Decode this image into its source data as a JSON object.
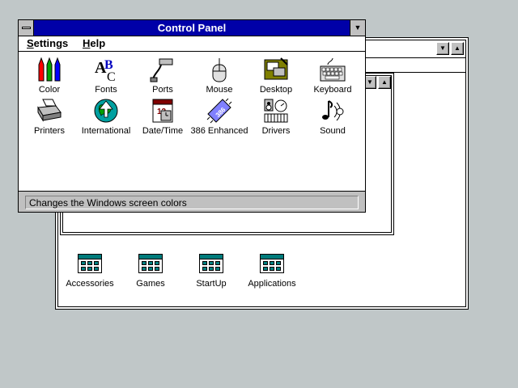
{
  "control_panel": {
    "title": "Control Panel",
    "menus": [
      {
        "label_first": "S",
        "label_rest": "ettings"
      },
      {
        "label_first": "H",
        "label_rest": "elp"
      }
    ],
    "items": [
      {
        "label": "Color",
        "icon": "color-icon",
        "selected": true
      },
      {
        "label": "Fonts",
        "icon": "fonts-icon"
      },
      {
        "label": "Ports",
        "icon": "ports-icon"
      },
      {
        "label": "Mouse",
        "icon": "mouse-icon"
      },
      {
        "label": "Desktop",
        "icon": "desktop-icon"
      },
      {
        "label": "Keyboard",
        "icon": "keyboard-icon"
      },
      {
        "label": "Printers",
        "icon": "printers-icon"
      },
      {
        "label": "International",
        "icon": "international-icon"
      },
      {
        "label": "Date/Time",
        "icon": "date-time-icon"
      },
      {
        "label": "386 Enhanced",
        "icon": "386-enhanced-icon"
      },
      {
        "label": "Drivers",
        "icon": "drivers-icon"
      },
      {
        "label": "Sound",
        "icon": "sound-icon"
      }
    ],
    "status_text": "Changes the Windows screen colors"
  },
  "program_manager": {
    "groups": [
      {
        "label": "Accessories",
        "icon": "program-group-icon"
      },
      {
        "label": "Games",
        "icon": "program-group-icon"
      },
      {
        "label": "StartUp",
        "icon": "program-group-icon"
      },
      {
        "label": "Applications",
        "icon": "program-group-icon"
      }
    ]
  },
  "colors": {
    "desktop": "#c0c7c8",
    "title_active": "#0000a8",
    "selection": "#000080"
  }
}
